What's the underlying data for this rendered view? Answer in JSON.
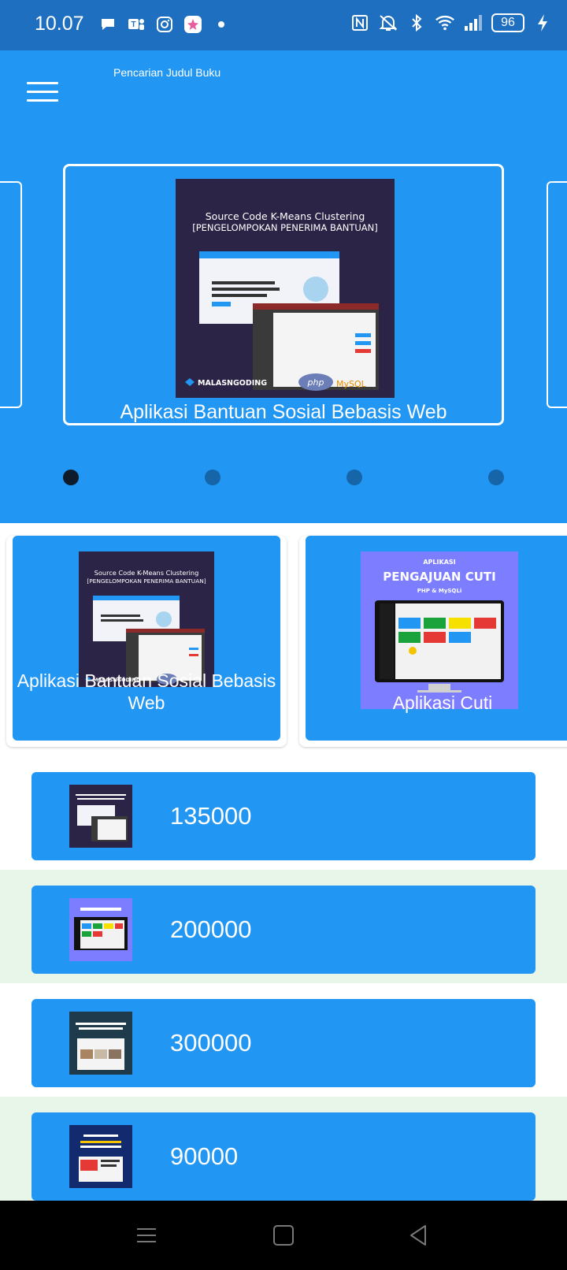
{
  "status_bar": {
    "time": "10.07",
    "battery": "96",
    "left_icons": [
      "chat-bubble-icon",
      "teams-icon",
      "instagram-icon",
      "photos-icon",
      "dot-icon"
    ],
    "right_icons": [
      "nfc-icon",
      "mute-icon",
      "bluetooth-icon",
      "wifi-icon",
      "signal-icon",
      "charging-icon"
    ]
  },
  "app_bar": {
    "title": "Pencarian Judul Buku",
    "menu_icon": "hamburger-menu-icon"
  },
  "carousel": {
    "caption": "Aplikasi Bantuan Sosial Bebasis Web",
    "image": {
      "title_line1": "Source Code K-Means Clustering",
      "title_line2": "[PENGELOMPOKAN PENERIMA BANTUAN]",
      "brand": "MALASNGODING",
      "tech1": "php",
      "tech2": "MySQL"
    },
    "dots": 4,
    "active_dot": 0
  },
  "cards": [
    {
      "caption": "Aplikasi Bantuan Sosial Bebasis Web",
      "img_title1": "Source Code K-Means Clustering",
      "img_title2": "[PENGELOMPOKAN PENERIMA BANTUAN]",
      "img_brand": "MALASNGODING"
    },
    {
      "caption": "Aplikasi Cuti",
      "img_title1": "APLIKASI",
      "img_title2": "PENGAJUAN CUTI",
      "img_title3": "PHP & MySQLi"
    }
  ],
  "list_items": [
    {
      "price": "135000",
      "thumb": "kmeans-thumbnail",
      "band": "#ffffff"
    },
    {
      "price": "200000",
      "thumb": "cuti-thumbnail",
      "band": "#e8f5e9"
    },
    {
      "price": "300000",
      "thumb": "hotel-thumbnail",
      "band": "#ffffff"
    },
    {
      "price": "90000",
      "thumb": "portal-berita-thumbnail",
      "band": "#e8f5e9"
    }
  ],
  "nav_bar": {
    "buttons": [
      "recent-apps-icon",
      "home-icon",
      "back-icon"
    ]
  },
  "colors": {
    "primary": "#2196f3",
    "status_bar": "#1e6fc0",
    "dot_inactive": "#1565a8",
    "dot_active": "#0d1b2a"
  }
}
